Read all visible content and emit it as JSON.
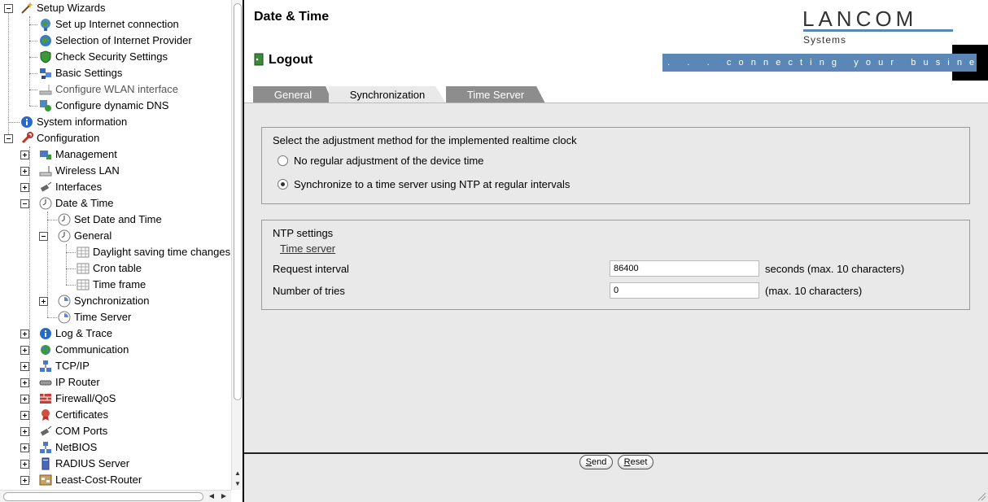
{
  "tree": {
    "setup_wizards": "Setup Wizards",
    "setup_internet": "Set up Internet connection",
    "internet_provider": "Selection of Internet Provider",
    "check_security": "Check Security Settings",
    "basic_settings": "Basic Settings",
    "configure_wlan": "Configure WLAN interface",
    "configure_dns": "Configure dynamic DNS",
    "system_information": "System information",
    "configuration": "Configuration",
    "management": "Management",
    "wireless_lan": "Wireless LAN",
    "interfaces": "Interfaces",
    "date_time": "Date & Time",
    "set_date_time": "Set Date and Time",
    "general": "General",
    "daylight_saving": "Daylight saving time changes",
    "cron_table": "Cron table",
    "time_frame": "Time frame",
    "synchronization": "Synchronization",
    "time_server": "Time Server",
    "log_trace": "Log & Trace",
    "communication": "Communication",
    "tcp_ip": "TCP/IP",
    "ip_router": "IP Router",
    "firewall_qos": "Firewall/QoS",
    "certificates": "Certificates",
    "com_ports": "COM Ports",
    "netbios": "NetBIOS",
    "radius_server": "RADIUS Server",
    "least_cost_router": "Least-Cost-Router"
  },
  "header": {
    "title": "Date & Time",
    "logout": "Logout",
    "logo": "LANCOM",
    "logo_sub": "Systems",
    "tagline": ". . .   connecting   your   business",
    "accent_color": "#5b87b6"
  },
  "tabs": {
    "general": "General",
    "synchronization": "Synchronization",
    "time_server": "Time Server",
    "active": "Synchronization"
  },
  "adjustment": {
    "title": "Select the adjustment method for the implemented realtime clock",
    "option_none": "No regular adjustment of the device time",
    "option_ntp": "Synchronize to a time server using NTP at regular intervals",
    "selected": "option_ntp"
  },
  "ntp": {
    "title": "NTP settings",
    "time_server_link": "Time server",
    "request_interval_label": "Request interval",
    "request_interval_value": "86400",
    "request_interval_hint": "seconds (max. 10 characters)",
    "tries_label": "Number of tries",
    "tries_value": "0",
    "tries_hint": "(max. 10 characters)"
  },
  "buttons": {
    "send_first": "S",
    "send_rest": "end",
    "reset_first": "R",
    "reset_rest": "eset"
  }
}
